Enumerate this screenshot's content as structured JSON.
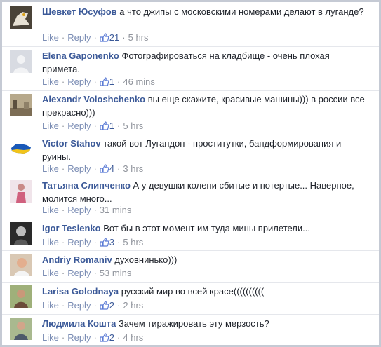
{
  "comments": [
    {
      "author": "Шевкет Юсуфов",
      "text": "а что джипы с московскими номерами делают в луганде?",
      "like": "Like",
      "reply": "Reply",
      "likes": "21",
      "time": "5 hrs",
      "avatar": "eagle-photo"
    },
    {
      "author": "Elena Gaponenko",
      "text": "Фотографироваться на кладбище - очень плохая примета.",
      "like": "Like",
      "reply": "Reply",
      "likes": "1",
      "time": "46 mins",
      "avatar": "default-avatar"
    },
    {
      "author": "Alexandr Voloshchenko",
      "text": "вы еще скажите, красивые машины))) в россии все прекрасно)))",
      "like": "Like",
      "reply": "Reply",
      "likes": "1",
      "time": "5 hrs",
      "avatar": "street-photo"
    },
    {
      "author": "Victor Stahov",
      "text": "такой вот Лугандон - проститутки, бандформирования и руины.",
      "like": "Like",
      "reply": "Reply",
      "likes": "4",
      "time": "3 hrs",
      "avatar": "ukraine-map"
    },
    {
      "author": "Татьяна Слипченко",
      "text": "А у девушки колени сбитые и потертые... Наверное, молится много...",
      "like": "Like",
      "reply": "Reply",
      "likes": "",
      "time": "31 mins",
      "avatar": "woman-photo"
    },
    {
      "author": "Igor Teslenko",
      "text": "Вот бы в этот момент им туда мины прилетели...",
      "like": "Like",
      "reply": "Reply",
      "likes": "3",
      "time": "5 hrs",
      "avatar": "bw-portrait"
    },
    {
      "author": "Andriy Romaniv",
      "text": "духовнинько)))",
      "like": "Like",
      "reply": "Reply",
      "likes": "",
      "time": "53 mins",
      "avatar": "man-photo"
    },
    {
      "author": "Larisa Golodnaya",
      "text": "русский мир во всей красе((((((((((",
      "like": "Like",
      "reply": "Reply",
      "likes": "2",
      "time": "2 hrs",
      "avatar": "woman-green"
    },
    {
      "author": "Людмила Кошта",
      "text": "Зачем тиражировать эту мерзость?",
      "like": "Like",
      "reply": "Reply",
      "likes": "2",
      "time": "4 hrs",
      "avatar": "woman-outdoor"
    }
  ],
  "colors": {
    "author": "#3b5998",
    "meta": "#90949c",
    "link": "#7b8db4",
    "border": "#c5cad4"
  }
}
